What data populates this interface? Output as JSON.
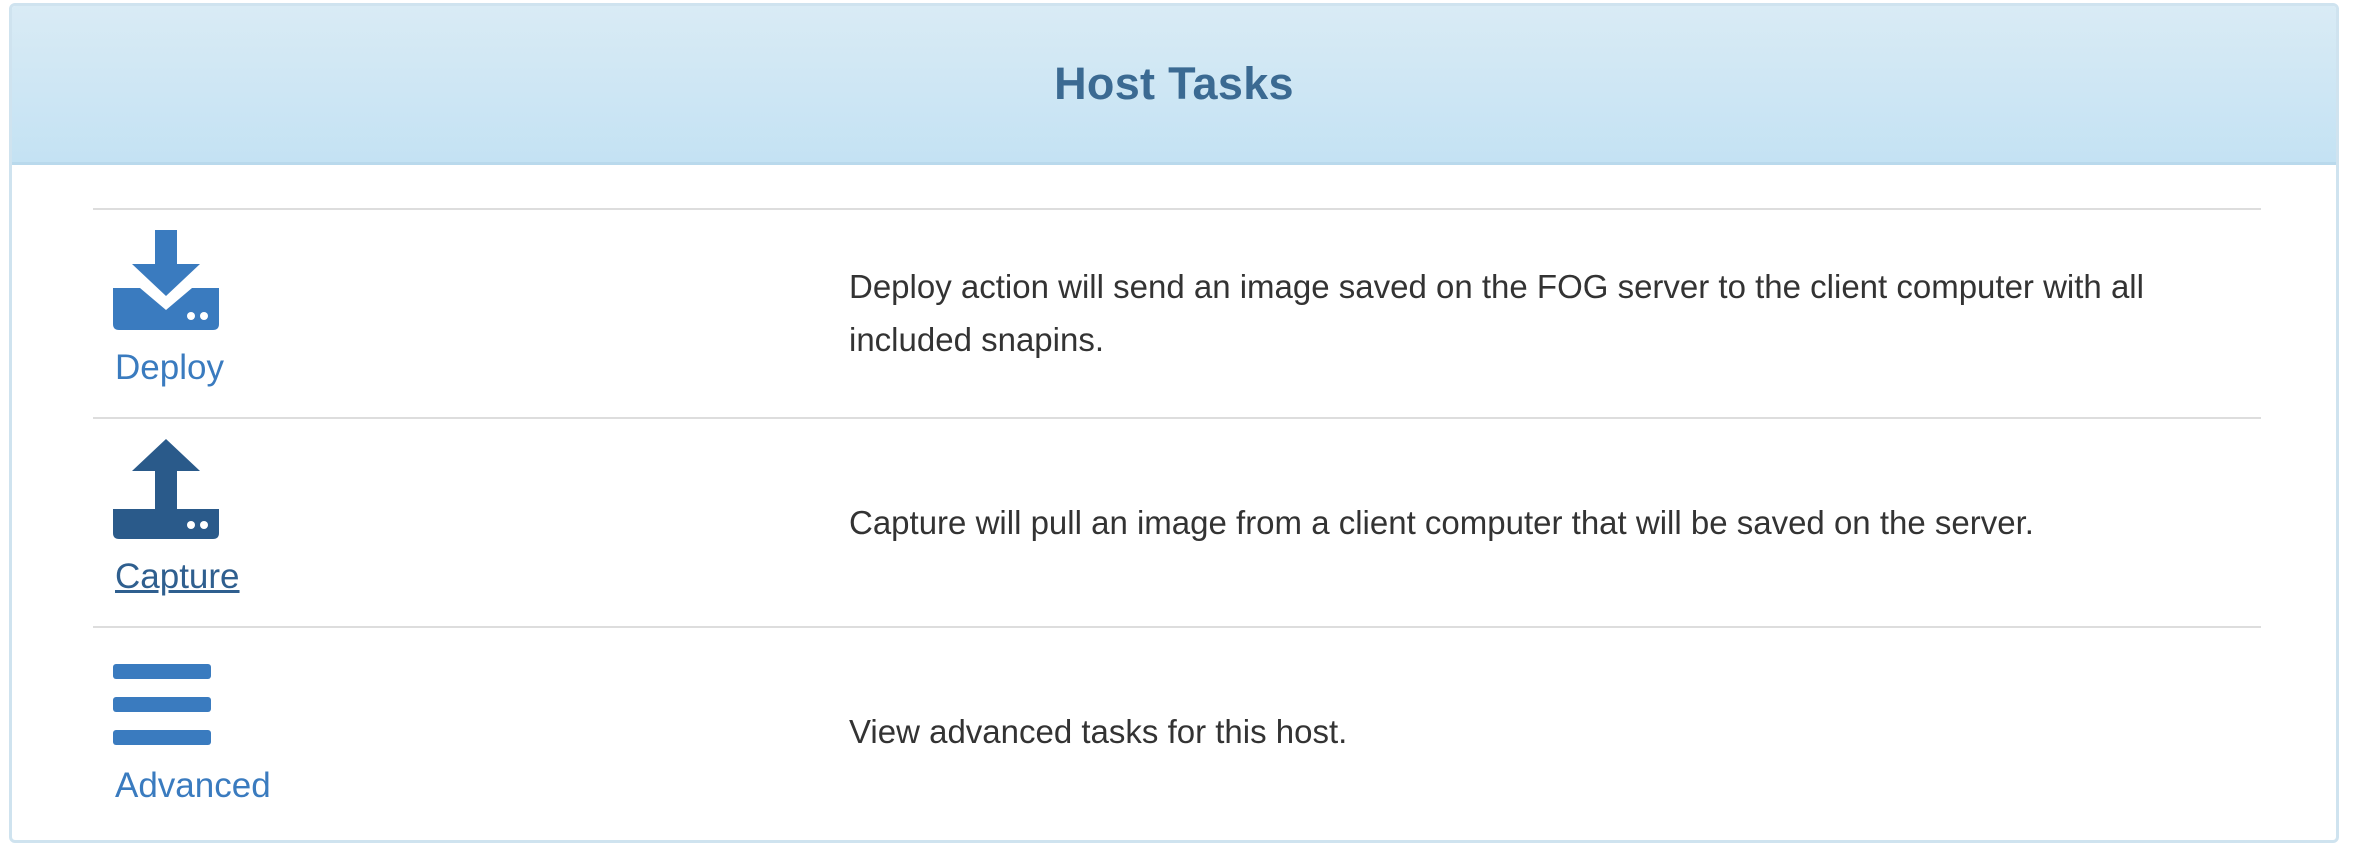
{
  "panel": {
    "title": "Host Tasks"
  },
  "tasks": [
    {
      "label": "Deploy",
      "icon": "download-drive-icon",
      "description": "Deploy action will send an image saved on the FOG server to the client computer with all included snapins."
    },
    {
      "label": "Capture",
      "icon": "upload-drive-icon",
      "description": "Capture will pull an image from a client computer that will be saved on the server."
    },
    {
      "label": "Advanced",
      "icon": "menu-bars-icon",
      "description": "View advanced tasks for this host."
    }
  ],
  "colors": {
    "accent": "#3a7bbf",
    "accent_dark": "#2a5a8a",
    "header_bg": "#cfe6f4",
    "title": "#3b6a92",
    "text": "#333333",
    "divider": "#dddddd"
  }
}
